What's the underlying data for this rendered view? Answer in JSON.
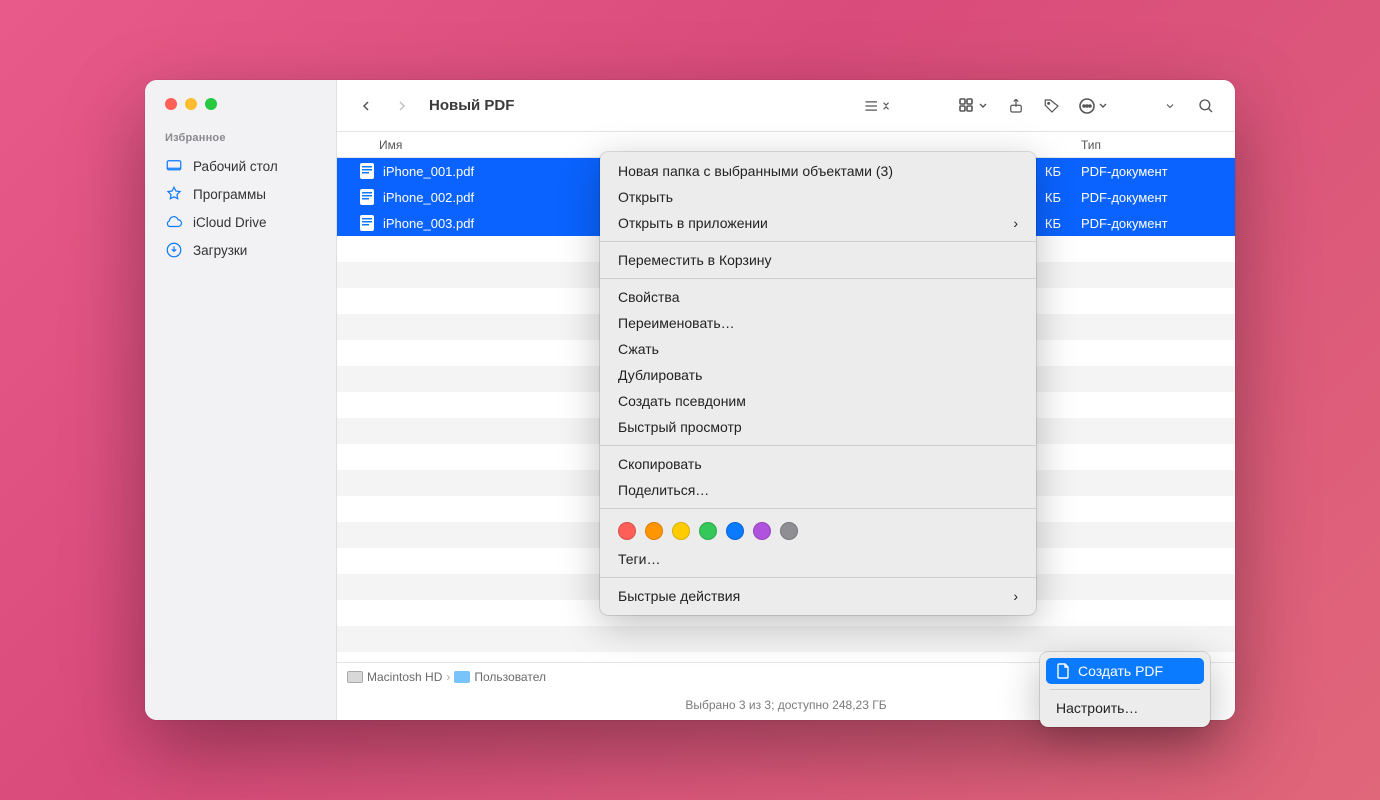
{
  "sidebar": {
    "section_label": "Избранное",
    "items": [
      {
        "label": "Рабочий стол"
      },
      {
        "label": "Программы"
      },
      {
        "label": "iCloud Drive"
      },
      {
        "label": "Загрузки"
      }
    ]
  },
  "toolbar": {
    "title": "Новый PDF"
  },
  "headers": {
    "name": "Имя",
    "type": "Тип"
  },
  "files": [
    {
      "name": "iPhone_001.pdf",
      "size": "КБ",
      "type": "PDF-документ"
    },
    {
      "name": "iPhone_002.pdf",
      "size": "КБ",
      "type": "PDF-документ"
    },
    {
      "name": "iPhone_003.pdf",
      "size": "КБ",
      "type": "PDF-документ"
    }
  ],
  "pathbar": {
    "root": "Macintosh HD",
    "next": "Пользовател"
  },
  "status": "Выбрано 3 из 3; доступно 248,23 ГБ",
  "context_menu": {
    "new_folder": "Новая папка с выбранными объектами (3)",
    "open": "Открыть",
    "open_with": "Открыть в приложении",
    "trash": "Переместить в Корзину",
    "info": "Свойства",
    "rename": "Переименовать…",
    "compress": "Сжать",
    "duplicate": "Дублировать",
    "alias": "Создать псевдоним",
    "quicklook": "Быстрый просмотр",
    "copy": "Скопировать",
    "share": "Поделиться…",
    "tags_label": "Теги…",
    "quick_actions": "Быстрые действия",
    "tag_colors": [
      "#ff5f57",
      "#ff9500",
      "#ffcc00",
      "#34c759",
      "#0a7aff",
      "#af52de",
      "#8e8e93"
    ]
  },
  "submenu": {
    "create_pdf": "Создать PDF",
    "customize": "Настроить…"
  }
}
